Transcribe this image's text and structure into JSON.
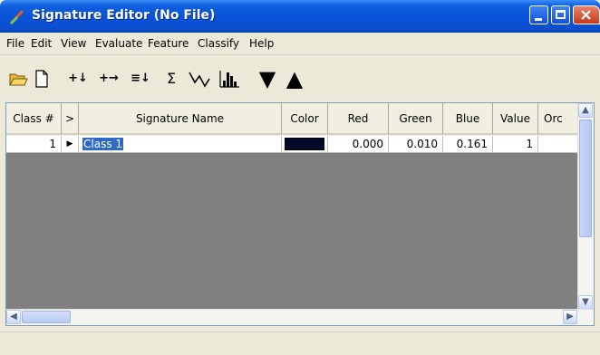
{
  "window": {
    "title": "Signature Editor (No File)"
  },
  "menu": [
    "File",
    "Edit",
    "View",
    "Evaluate",
    "Feature",
    "Classify",
    "Help"
  ],
  "toolbar": {
    "open_icon": "folder-open-icon",
    "new_icon": "new-document-icon",
    "add_label": "+↓",
    "merge_label": "+→",
    "append_label": "≡↓",
    "sum_label": "Σ",
    "down_label": "▼",
    "up_label": "▲"
  },
  "grid": {
    "columns": [
      "Class #",
      ">",
      "Signature Name",
      "Color",
      "Red",
      "Green",
      "Blue",
      "Value",
      "Orc"
    ],
    "rows": [
      {
        "class_num": "1",
        "pointer": "▶",
        "name": "Class 1",
        "color": "#020a29",
        "red": "0.000",
        "green": "0.010",
        "blue": "0.161",
        "value": "1",
        "order": ""
      }
    ]
  }
}
